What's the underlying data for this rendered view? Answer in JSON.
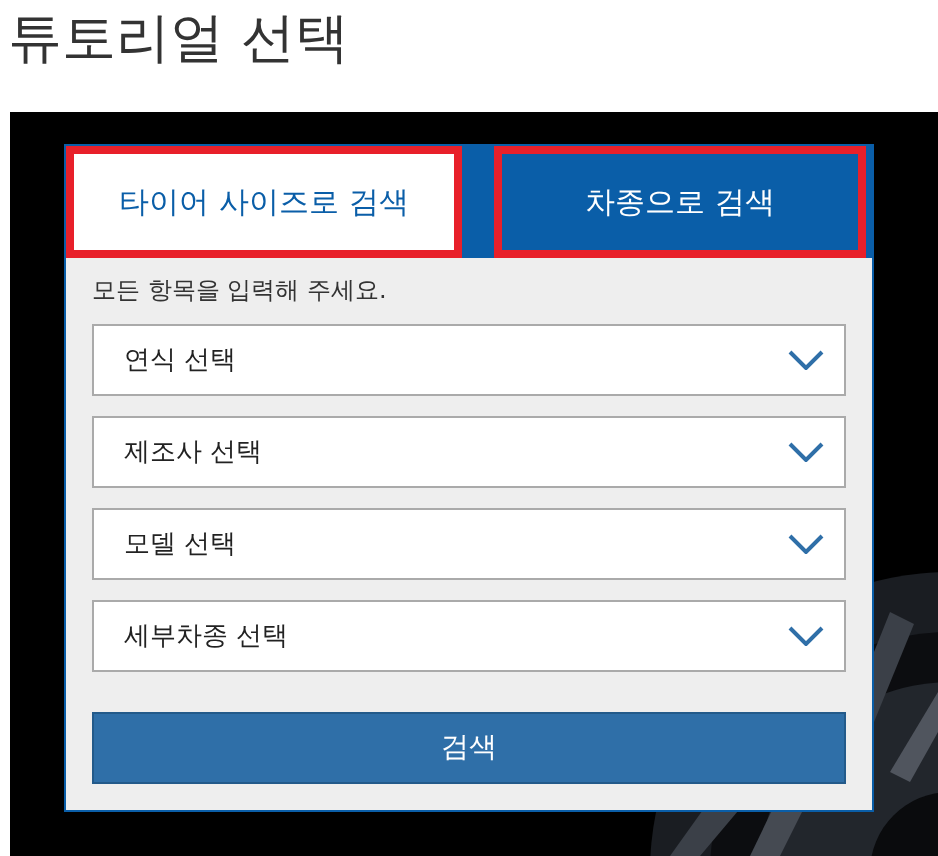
{
  "title": "튜토리얼 선택",
  "tabs": [
    {
      "label": "타이어 사이즈로 검색",
      "selected": false,
      "highlighted": true
    },
    {
      "label": "차종으로 검색",
      "selected": true,
      "highlighted": true
    }
  ],
  "hint": "모든 항목을 입력해 주세요.",
  "selects": [
    {
      "placeholder": "연식 선택"
    },
    {
      "placeholder": "제조사 선택"
    },
    {
      "placeholder": "모델 선택"
    },
    {
      "placeholder": "세부차종 선택"
    }
  ],
  "search_button": "검색"
}
